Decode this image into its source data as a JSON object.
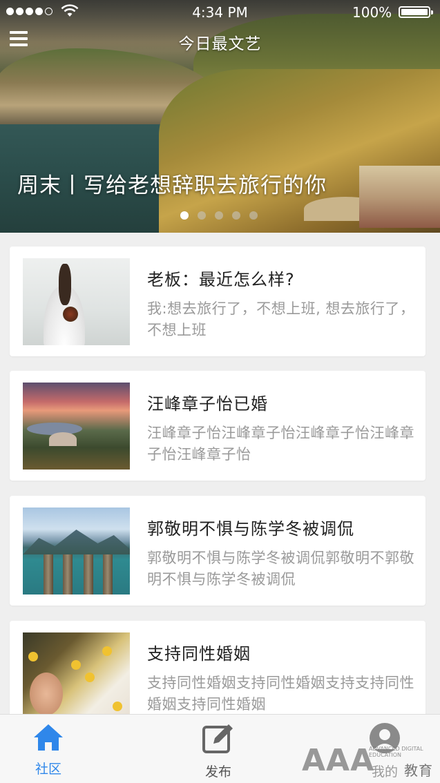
{
  "status_bar": {
    "time": "4:34 PM",
    "battery": "100%",
    "signal_dots_filled": 4,
    "signal_dots_total": 5
  },
  "nav": {
    "title": "今日最文艺",
    "menu_icon": "hamburger-menu-icon"
  },
  "banner": {
    "caption": "周末丨写给老想辞职去旅行的你",
    "page_count": 5,
    "active_page": 1
  },
  "articles": [
    {
      "title": "老板：最近怎么样?",
      "summary": "我:想去旅行了，不想上班, 想去旅行了，不想上班"
    },
    {
      "title": "汪峰章子怡已婚",
      "summary": "汪峰章子怡汪峰章子怡汪峰章子怡汪峰章子怡汪峰章子怡"
    },
    {
      "title": "郭敬明不惧与陈学冬被调侃",
      "summary": "郭敬明不惧与陈学冬被调侃郭敬明不郭敬明不惧与陈学冬被调侃"
    },
    {
      "title": "支持同性婚姻",
      "summary": "支持同性婚姻支持同性婚姻支持支持同性婚姻支持同性婚姻"
    }
  ],
  "tabbar": {
    "tabs": [
      {
        "label": "社区",
        "icon": "home-icon",
        "active": true
      },
      {
        "label": "发布",
        "icon": "edit-icon",
        "active": false
      },
      {
        "label": "我的",
        "icon": "user-icon",
        "active": false
      }
    ]
  },
  "watermark": {
    "brand": "AAA",
    "small_text": "ADVANCED DIGITAL EDUCATION",
    "sub": "教育"
  },
  "colors": {
    "accent": "#2f87ea",
    "card_bg": "#ffffff",
    "page_bg": "#efefef",
    "title_text": "#222222",
    "summary_text": "#9a9a9a"
  }
}
